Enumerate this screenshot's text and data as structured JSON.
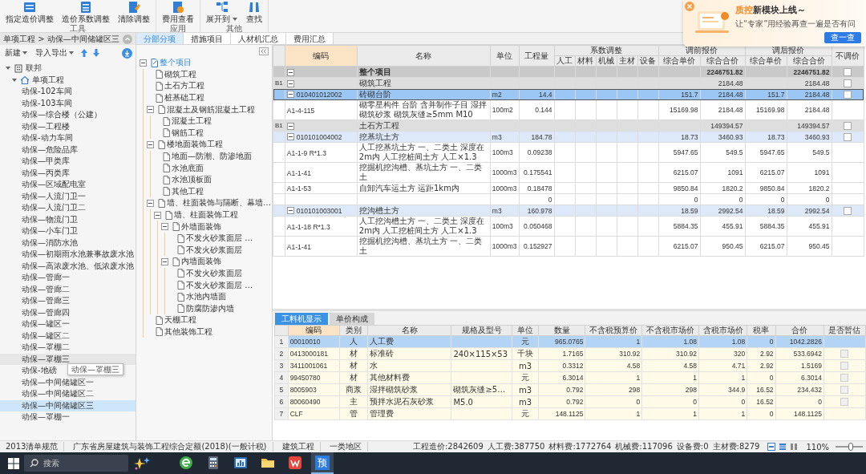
{
  "ribbon": {
    "groups": [
      {
        "label": "工具",
        "buttons": [
          {
            "label": "指定造价调整",
            "has_menu": false
          },
          {
            "label": "造价系数调整",
            "has_menu": false
          },
          {
            "label": "清除调整",
            "has_menu": false
          }
        ]
      },
      {
        "label": "应用",
        "buttons": [
          {
            "label": "费用查看",
            "has_menu": false
          }
        ]
      },
      {
        "label": "其他",
        "buttons": [
          {
            "label": "展开到",
            "has_menu": true
          },
          {
            "label": "查找",
            "has_menu": false
          }
        ]
      }
    ]
  },
  "notification": {
    "brand": "质控",
    "title": "新模块上线～",
    "message": "让“专家”用经验再查一遍是否有问",
    "button": "查一查"
  },
  "breadcrumb": "单项工程 > 动保—中间储罐区三",
  "left_toolbar": [
    {
      "label": "新建"
    },
    {
      "label": "导入导出"
    }
  ],
  "project_tree": [
    {
      "label": "联邦",
      "selected": false,
      "expanded": true,
      "children": [
        {
          "label": "单项工程",
          "selected": false,
          "expanded": true,
          "children": [
            {
              "label": "动保-102车间",
              "selected": false,
              "hovered": false
            },
            {
              "label": "动保-103车间",
              "selected": false,
              "hovered": false
            },
            {
              "label": "动保—综合楼（公建）",
              "selected": false,
              "hovered": false
            },
            {
              "label": "动保—工程楼",
              "selected": false,
              "hovered": false
            },
            {
              "label": "动保-动力车间",
              "selected": false,
              "hovered": false
            },
            {
              "label": "动保—危险品库",
              "selected": false,
              "hovered": false
            },
            {
              "label": "动保—甲类库",
              "selected": false,
              "hovered": false
            },
            {
              "label": "动保—丙类库",
              "selected": false,
              "hovered": false
            },
            {
              "label": "动保—区域配电室",
              "selected": false,
              "hovered": false
            },
            {
              "label": "动保—人流门卫一",
              "selected": false,
              "hovered": false
            },
            {
              "label": "动保—人流门卫二",
              "selected": false,
              "hovered": false
            },
            {
              "label": "动保—物流门卫",
              "selected": false,
              "hovered": false
            },
            {
              "label": "动保—小车门卫",
              "selected": false,
              "hovered": false
            },
            {
              "label": "动保—消防水池",
              "selected": false,
              "hovered": false
            },
            {
              "label": "动保—初期雨水池兼事故废水池",
              "selected": false,
              "hovered": false
            },
            {
              "label": "动保—高浓废水池、低浓废水池",
              "selected": false,
              "hovered": false
            },
            {
              "label": "动保—管廊一",
              "selected": false,
              "hovered": false
            },
            {
              "label": "动保—管廊二",
              "selected": false,
              "hovered": false
            },
            {
              "label": "动保—管廊三",
              "selected": false,
              "hovered": false
            },
            {
              "label": "动保—管廊四",
              "selected": false,
              "hovered": false
            },
            {
              "label": "动保—罐区一",
              "selected": false,
              "hovered": false
            },
            {
              "label": "动保—罐区二",
              "selected": false,
              "hovered": false
            },
            {
              "label": "动保—罩棚二",
              "selected": false,
              "hovered": false
            },
            {
              "label": "动保—罩棚三",
              "selected": false,
              "hovered": true
            },
            {
              "label": "动保-地磅",
              "selected": false,
              "hovered": false
            },
            {
              "label": "动保—中间储罐区一",
              "selected": false,
              "hovered": false
            },
            {
              "label": "动保—中间储罐区二",
              "selected": false,
              "hovered": false
            },
            {
              "label": "动保—中间储罐区三",
              "selected": true,
              "hovered": false
            },
            {
              "label": "动保—罩棚一",
              "selected": false,
              "hovered": false
            }
          ]
        }
      ]
    }
  ],
  "tooltip": "动保—罩棚三",
  "view_tabs": [
    {
      "label": "分部分项",
      "selected": true
    },
    {
      "label": "措施项目",
      "selected": false
    },
    {
      "label": "人材机汇总",
      "selected": false
    },
    {
      "label": "费用汇总",
      "selected": false
    }
  ],
  "section_tree": [
    {
      "label": "整个项目",
      "selected": true,
      "expanded": true,
      "children": [
        {
          "label": "砌筑工程",
          "selected": false
        },
        {
          "label": "土石方工程",
          "selected": false
        },
        {
          "label": "桩基础工程",
          "selected": false
        },
        {
          "label": "混凝土及钢筋混凝土工程",
          "selected": false,
          "expanded": true,
          "children": [
            {
              "label": "混凝土工程",
              "selected": false
            },
            {
              "label": "钢筋工程",
              "selected": false
            }
          ]
        },
        {
          "label": "楼地面装饰工程",
          "selected": false,
          "expanded": true,
          "children": [
            {
              "label": "地面—防潮、防渗地面",
              "selected": false
            },
            {
              "label": "水池底面",
              "selected": false
            },
            {
              "label": "水池顶板面",
              "selected": false
            },
            {
              "label": "其他工程",
              "selected": false
            }
          ]
        },
        {
          "label": "墙、柱面装饰与隔断、幕墙…",
          "selected": false,
          "expanded": true,
          "children": [
            {
              "label": "墙、柱面装饰工程",
              "selected": false,
              "expanded": true,
              "children": [
                {
                  "label": "外墙面装饰",
                  "selected": false,
                  "expanded": true,
                  "children": [
                    {
                      "label": "不发火砂浆面层 …",
                      "selected": false
                    },
                    {
                      "label": "不发火砂浆面层",
                      "selected": false
                    }
                  ]
                },
                {
                  "label": "内墙面装饰",
                  "selected": false,
                  "expanded": true,
                  "children": [
                    {
                      "label": "不发火砂浆面层",
                      "selected": false
                    },
                    {
                      "label": "不发火砂浆面层 …",
                      "selected": false
                    },
                    {
                      "label": "水池内墙面",
                      "selected": false
                    },
                    {
                      "label": "防腐防渗内墙",
                      "selected": false
                    }
                  ]
                }
              ]
            }
          ]
        },
        {
          "label": "天棚工程",
          "selected": false
        },
        {
          "label": "其他装饰工程",
          "selected": false
        }
      ]
    }
  ],
  "grid": {
    "headers": {
      "code": "编码",
      "name": "名称",
      "unit": "单位",
      "quantity": "工程量",
      "coefficient": {
        "label": "系数调整",
        "columns": [
          "人工",
          "材料",
          "机械",
          "主材",
          "设备"
        ]
      },
      "before": {
        "label": "调前报价",
        "columns": [
          "综合单价",
          "综合合价"
        ]
      },
      "after": {
        "label": "调后报价",
        "columns": [
          "综合单价",
          "综合合价"
        ]
      },
      "no_adjust": "不调价"
    },
    "rows": [
      {
        "kind": "total",
        "name": "整个项目",
        "before_total": "2246751.82",
        "after_total": "2246751.82",
        "expanded": true,
        "checked": false,
        "selected": false
      },
      {
        "kind": "section",
        "marker": "B1",
        "name": "砌筑工程",
        "before_total": "2184.48",
        "after_total": "2184.48",
        "expanded": true,
        "checked": false,
        "selected": false
      },
      {
        "kind": "item",
        "code": "010401012002",
        "name": "砖砌台阶",
        "unit": "m2",
        "quantity": "14.4",
        "before_unit": "151.7",
        "before_total": "2184.48",
        "after_unit": "151.7",
        "after_total": "2184.48",
        "expanded": true,
        "checked": false,
        "selected": true
      },
      {
        "kind": "sub",
        "code": "A1-4-115",
        "name": "砌零星构件 台阶 含并制作子目 湿拌砌筑砂浆 砌筑灰缝≥5mm M10",
        "unit": "100m2",
        "quantity": "0.144",
        "before_unit": "15169.98",
        "before_total": "2184.48",
        "after_unit": "15169.98",
        "after_total": "2184.48",
        "selected": false
      },
      {
        "kind": "section",
        "marker": "B1",
        "name": "土石方工程",
        "before_total": "149394.57",
        "after_total": "149394.57",
        "expanded": true,
        "checked": false,
        "selected": false
      },
      {
        "kind": "item",
        "code": "010101004002",
        "name": "挖基坑土方",
        "unit": "m3",
        "quantity": "184.78",
        "before_unit": "18.73",
        "before_total": "3460.93",
        "after_unit": "18.73",
        "after_total": "3460.93",
        "expanded": true,
        "checked": false,
        "selected": false
      },
      {
        "kind": "sub",
        "code": "A1-1-9 R*1.3",
        "name": "人工挖基坑土方 一、二类土 深度在2m内 人工挖桩间土方 人工×1.3",
        "unit": "100m3",
        "quantity": "0.09238",
        "before_unit": "5947.65",
        "before_total": "549.5",
        "after_unit": "5947.65",
        "after_total": "549.5",
        "selected": false
      },
      {
        "kind": "sub",
        "code": "A1-1-41",
        "name": "挖掘机挖沟槽、基坑土方 一、二类土",
        "unit": "1000m3",
        "quantity": "0.175541",
        "before_unit": "6215.07",
        "before_total": "1091",
        "after_unit": "6215.07",
        "after_total": "1091",
        "selected": false
      },
      {
        "kind": "sub",
        "code": "A1-1-53",
        "name": "自卸汽车运土方 运距1km内",
        "unit": "1000m3",
        "quantity": "0.18478",
        "before_unit": "9850.84",
        "before_total": "1820.2",
        "after_unit": "9850.84",
        "after_total": "1820.2",
        "selected": false
      },
      {
        "kind": "sub",
        "quantity": "0",
        "before_unit": "0",
        "before_total": "0",
        "after_unit": "0",
        "after_total": "0",
        "selected": false
      },
      {
        "kind": "item",
        "code": "010101003001",
        "name": "挖沟槽土方",
        "unit": "m3",
        "quantity": "160.978",
        "before_unit": "18.59",
        "before_total": "2992.54",
        "after_unit": "18.59",
        "after_total": "2992.54",
        "expanded": true,
        "checked": false,
        "selected": false
      },
      {
        "kind": "sub",
        "code": "A1-1-18 R*1.3",
        "name": "人工挖沟槽土方 一、二类土 深度在2m内 人工挖桩间土方 人工×1.3",
        "unit": "100m3",
        "quantity": "0.050468",
        "before_unit": "5884.35",
        "before_total": "455.91",
        "after_unit": "5884.35",
        "after_total": "455.91",
        "selected": false
      },
      {
        "kind": "sub",
        "code": "A1-1-41",
        "name": "挖掘机挖沟槽、基坑土方 一、二类土",
        "unit": "1000m3",
        "quantity": "0.152927",
        "before_unit": "6215.07",
        "before_total": "950.45",
        "after_unit": "6215.07",
        "after_total": "950.45",
        "selected": false
      }
    ]
  },
  "detail_tabs": [
    {
      "label": "工料机显示",
      "selected": true
    },
    {
      "label": "单价构成",
      "selected": false
    }
  ],
  "detail_table": {
    "columns": [
      "编码",
      "类别",
      "名称",
      "规格及型号",
      "单位",
      "数量",
      "不含税预算价",
      "不含税市场价",
      "含税市场价",
      "税率",
      "合价",
      "是否暂估"
    ],
    "rows": [
      {
        "number": "1",
        "code": "00010010",
        "type": "人",
        "name": "人工费",
        "unit": "元",
        "quantity": "965.0765",
        "budget_price": "1",
        "market_price": "1.08",
        "market_price_tax": "1.08",
        "tax_rate": "0",
        "total": "1042.2826",
        "selected": true
      },
      {
        "number": "2",
        "code": "0413000181",
        "type": "材",
        "name": "标准砖",
        "spec": "240×115×53",
        "unit": "千块",
        "quantity": "1.7165",
        "budget_price": "310.92",
        "market_price": "310.92",
        "market_price_tax": "320",
        "tax_rate": "2.92",
        "total": "533.6942",
        "estimated": false,
        "selected": false
      },
      {
        "number": "3",
        "code": "3411001061",
        "type": "材",
        "name": "水",
        "unit": "m3",
        "quantity": "0.3312",
        "budget_price": "4.58",
        "market_price": "4.58",
        "market_price_tax": "4.71",
        "tax_rate": "2.92",
        "total": "1.5169",
        "estimated": false,
        "selected": false
      },
      {
        "number": "4",
        "code": "99450780",
        "type": "材",
        "name": "其他材料费",
        "unit": "元",
        "quantity": "6.3014",
        "budget_price": "1",
        "market_price": "1",
        "market_price_tax": "1",
        "tax_rate": "0",
        "total": "6.3014",
        "estimated": false,
        "selected": false
      },
      {
        "number": "5",
        "code": "8005903",
        "type": "商浆",
        "name": "湿拌砌筑砂浆",
        "spec": "砌筑灰缝≥5…",
        "unit": "m3",
        "quantity": "0.792",
        "budget_price": "298",
        "market_price": "298",
        "market_price_tax": "344.9",
        "tax_rate": "16.52",
        "total": "234.432",
        "estimated": false,
        "selected": false
      },
      {
        "number": "6",
        "code": "80060490",
        "type": "主",
        "name": "预拌水泥石灰砂浆",
        "spec": "M5.0",
        "unit": "m3",
        "quantity": "0.792",
        "budget_price": "0",
        "market_price": "0",
        "market_price_tax": "0",
        "tax_rate": "16.52",
        "total": "0",
        "estimated": false,
        "selected": false
      },
      {
        "number": "7",
        "code": "CLF",
        "type": "管",
        "name": "管理费",
        "unit": "元",
        "quantity": "148.1125",
        "budget_price": "1",
        "market_price": "1",
        "market_price_tax": "1",
        "tax_rate": "0",
        "total": "148.1125",
        "selected": false
      }
    ]
  },
  "status_bar": {
    "items": [
      "2013清单规范",
      "广东省房屋建筑与装饰工程综合定额(2018)(一般计税)",
      "建筑工程",
      "一类地区"
    ],
    "totals": [
      "工程造价:2842609",
      "人工费:387750",
      "材料费:1772764",
      "机械费:117096",
      "设备费:0",
      "主材费:8279"
    ],
    "zoom": "110%",
    "zoom_slider": {
      "level": 0.55
    }
  },
  "taskbar": {
    "search": {
      "placeholder": "搜索"
    },
    "apps": [
      {
        "kind": "browser",
        "active": false
      },
      {
        "kind": "calculator",
        "active": false
      },
      {
        "kind": "chart",
        "active": false
      },
      {
        "kind": "folder",
        "active": false
      },
      {
        "kind": "office",
        "active": false
      },
      {
        "kind": "tile",
        "label": "预",
        "active": true
      }
    ]
  }
}
